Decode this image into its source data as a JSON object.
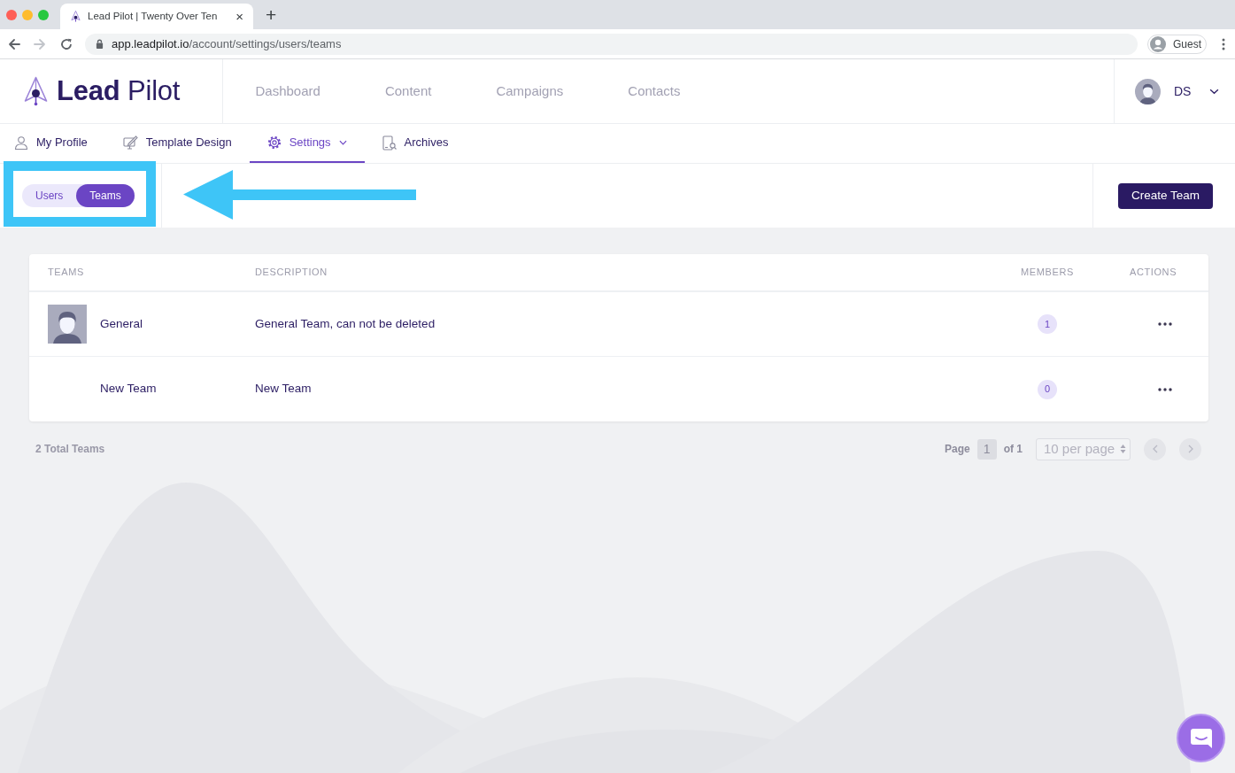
{
  "browser": {
    "tab": {
      "title": "Lead Pilot | Twenty Over Ten",
      "close": "×"
    },
    "new_tab": "+",
    "history_buttons": [
      {
        "kind": "back",
        "disabled": false
      },
      {
        "kind": "forward",
        "disabled": true
      }
    ],
    "url": {
      "host": "app.leadpilot.io",
      "path": "/account/settings/users/teams"
    },
    "profile": "Guest"
  },
  "header": {
    "logo": "**Lead** Pilot",
    "nav": [
      {
        "label": "Dashboard"
      },
      {
        "label": "Content"
      },
      {
        "label": "Campaigns"
      },
      {
        "label": "Contacts"
      }
    ],
    "user": {
      "initials": "DS"
    }
  },
  "subnav": [
    {
      "label": "My Profile",
      "kind": "person",
      "selected": false,
      "dropdown": false
    },
    {
      "label": "Template Design",
      "kind": "design",
      "selected": false,
      "dropdown": false
    },
    {
      "label": "Settings",
      "kind": "gear",
      "selected": true,
      "dropdown": true
    },
    {
      "label": "Archives",
      "kind": "archive",
      "selected": false,
      "dropdown": false
    }
  ],
  "toggle": [
    {
      "label": "Users",
      "selected": false
    },
    {
      "label": "Teams",
      "selected": true
    }
  ],
  "create_button": "Create Team",
  "table": {
    "columns": [
      "TEAMS",
      "DESCRIPTION",
      "MEMBERS",
      "ACTIONS"
    ],
    "rows": [
      {
        "name": "General",
        "avatar": true,
        "description": "General Team, can not be deleted",
        "members": "1"
      },
      {
        "name": "New Team",
        "avatar": false,
        "description": "New Team",
        "members": "0"
      }
    ]
  },
  "footer": {
    "total": "2 Total Teams",
    "page_label": "Page",
    "page": "1",
    "page_of": "of 1",
    "per_page": "10 per page",
    "pager_buttons": [
      {
        "kind": "prev",
        "disabled": true
      },
      {
        "kind": "next",
        "disabled": true
      }
    ]
  }
}
